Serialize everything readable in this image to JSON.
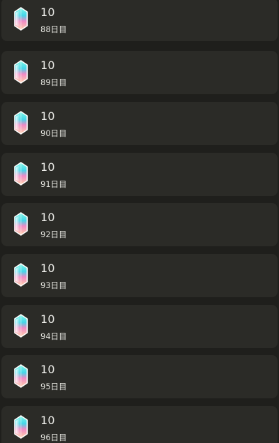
{
  "rewards": [
    {
      "icon": "crystal-icon",
      "amount": "10",
      "day": "88日目"
    },
    {
      "icon": "crystal-icon",
      "amount": "10",
      "day": "89日目"
    },
    {
      "icon": "crystal-icon",
      "amount": "10",
      "day": "90日目"
    },
    {
      "icon": "crystal-icon",
      "amount": "10",
      "day": "91日目"
    },
    {
      "icon": "crystal-icon",
      "amount": "10",
      "day": "92日目"
    },
    {
      "icon": "crystal-icon",
      "amount": "10",
      "day": "93日目"
    },
    {
      "icon": "crystal-icon",
      "amount": "10",
      "day": "94日目"
    },
    {
      "icon": "crystal-icon",
      "amount": "10",
      "day": "95日目"
    },
    {
      "icon": "crystal-icon",
      "amount": "10",
      "day": "96日目"
    }
  ],
  "colors": {
    "background": "#1f1f1c",
    "card": "#2b2b27",
    "text": "#f2f2ee"
  }
}
